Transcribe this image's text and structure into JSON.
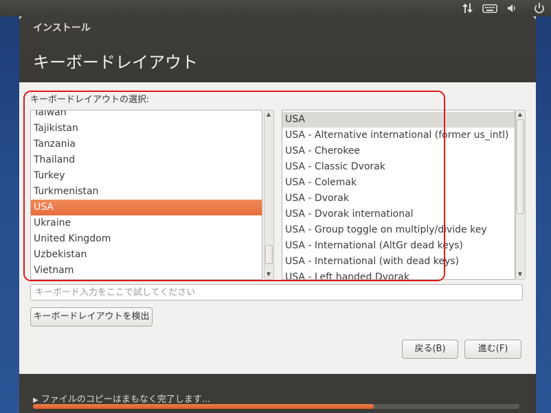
{
  "window": {
    "title": "インストール",
    "page_title": "キーボードレイアウト"
  },
  "panel": {
    "icons": [
      "network-updown-icon",
      "keyboard-icon",
      "volume-icon",
      "power-icon"
    ]
  },
  "layout": {
    "label": "キーボードレイアウトの選択:",
    "countries": [
      "Taiwan",
      "Tajikistan",
      "Tanzania",
      "Thailand",
      "Turkey",
      "Turkmenistan",
      "USA",
      "Ukraine",
      "United Kingdom",
      "Uzbekistan",
      "Vietnam"
    ],
    "selected_country": "USA",
    "variants": [
      "USA",
      "USA - Alternative international (former us_intl)",
      "USA - Cherokee",
      "USA - Classic Dvorak",
      "USA - Colemak",
      "USA - Dvorak",
      "USA - Dvorak international",
      "USA - Group toggle on multiply/divide key",
      "USA - International (AltGr dead keys)",
      "USA - International (with dead keys)",
      "USA - Left handed Dvorak"
    ],
    "selected_variant": "USA"
  },
  "test_input": {
    "placeholder": "キーボード入力をここで試してください",
    "value": ""
  },
  "buttons": {
    "detect": "キーボードレイアウトを検出",
    "back": "戻る(B)",
    "forward": "進む(F)"
  },
  "status": {
    "text": "ファイルのコピーはまもなく完了します...",
    "progress_percent": 70
  },
  "colors": {
    "accent": "#e76e3c",
    "highlight_frame": "#e01818"
  }
}
